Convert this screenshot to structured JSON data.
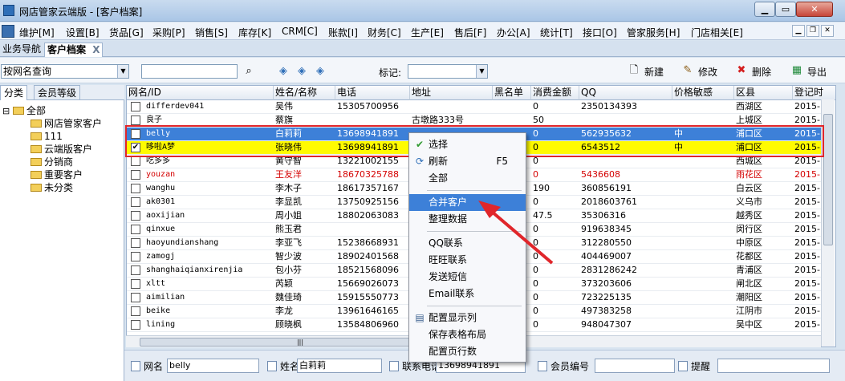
{
  "window": {
    "title": "网店管家云端版 - [客户档案]"
  },
  "menu": [
    "维护[M]",
    "设置[B]",
    "货品[G]",
    "采购[P]",
    "销售[S]",
    "库存[K]",
    "CRM[C]",
    "账款[I]",
    "财务[C]",
    "生产[E]",
    "售后[F]",
    "办公[A]",
    "统计[T]",
    "接口[O]",
    "管家服务[H]",
    "门店相关[E]"
  ],
  "tabs": {
    "nav": "业务导航",
    "active": "客户档案",
    "close": "X"
  },
  "toolbar": {
    "search_mode": "按网名查询",
    "mark_label": "标记:",
    "new": "新建",
    "edit": "修改",
    "delete": "删除",
    "export": "导出"
  },
  "sidebar": {
    "tabs": [
      "分类",
      "会员等级"
    ],
    "tree": [
      "全部",
      "网店管家客户",
      "111",
      "云端版客户",
      "分销商",
      "重要客户",
      "未分类"
    ],
    "toggle": "⊟"
  },
  "grid": {
    "columns": [
      "网名/ID",
      "姓名/名称",
      "电话",
      "地址",
      "黑名单",
      "消费金额",
      "QQ",
      "价格敏感",
      "区县",
      "登记时"
    ],
    "rows": [
      {
        "nick": "differdev041",
        "name": "吴伟",
        "phone": "15305700956",
        "addr": "",
        "black": "",
        "amount": "0",
        "qq": "2350134393",
        "price": "",
        "district": "西湖区",
        "reg": "2015-",
        "checked": "",
        "style": ""
      },
      {
        "nick": "良子",
        "name": "蔡旗",
        "phone": "",
        "addr": "古墩路333号",
        "black": "",
        "amount": "50",
        "qq": "",
        "price": "",
        "district": "上城区",
        "reg": "2015-",
        "checked": "",
        "style": ""
      },
      {
        "nick": "belly",
        "name": "白莉莉",
        "phone": "13698941891",
        "addr": "",
        "black": "",
        "amount": "0",
        "qq": "562935632",
        "price": "中",
        "district": "浦口区",
        "reg": "2015-",
        "checked": "✔",
        "style": "sel"
      },
      {
        "nick": "哆啦A梦",
        "name": "张晓伟",
        "phone": "13698941891",
        "addr": "",
        "black": "",
        "amount": "0",
        "qq": "6543512",
        "price": "中",
        "district": "浦口区",
        "reg": "2015-",
        "checked": "✔",
        "style": "hl"
      },
      {
        "nick": "吃多多",
        "name": "黄守智",
        "phone": "13221002155",
        "addr": "",
        "black": "",
        "amount": "0",
        "qq": "",
        "price": "",
        "district": "西城区",
        "reg": "2015-",
        "checked": "",
        "style": ""
      },
      {
        "nick": "youzan",
        "name": "王友洋",
        "phone": "18670325788",
        "addr": "",
        "black": "",
        "amount": "0",
        "qq": "5436608",
        "price": "",
        "district": "雨花区",
        "reg": "2015-",
        "checked": "",
        "style": "red"
      },
      {
        "nick": "wanghu",
        "name": "李木子",
        "phone": "18617357167",
        "addr": "",
        "black": "",
        "amount": "190",
        "qq": "360856191",
        "price": "",
        "district": "白云区",
        "reg": "2015-",
        "checked": "",
        "style": ""
      },
      {
        "nick": "ak0301",
        "name": "李显凯",
        "phone": "13750925156",
        "addr": "",
        "black": "",
        "amount": "0",
        "qq": "2018603761",
        "price": "",
        "district": "义乌市",
        "reg": "2015-",
        "checked": "",
        "style": ""
      },
      {
        "nick": "aoxijian",
        "name": "周小姐",
        "phone": "18802063083",
        "addr": "",
        "black": "",
        "amount": "47.5",
        "qq": "35306316",
        "price": "",
        "district": "越秀区",
        "reg": "2015-",
        "checked": "",
        "style": ""
      },
      {
        "nick": "qinxue",
        "name": "熊玉君",
        "phone": "",
        "addr": "",
        "black": "",
        "amount": "0",
        "qq": "919638345",
        "price": "",
        "district": "闵行区",
        "reg": "2015-",
        "checked": "",
        "style": ""
      },
      {
        "nick": "haoyundianshang",
        "name": "李亚飞",
        "phone": "15238668931",
        "addr": "",
        "black": "",
        "amount": "0",
        "qq": "312280550",
        "price": "",
        "district": "中原区",
        "reg": "2015-",
        "checked": "",
        "style": ""
      },
      {
        "nick": "zamogj",
        "name": "智少波",
        "phone": "18902401568",
        "addr": "",
        "black": "",
        "amount": "0",
        "qq": "404469007",
        "price": "",
        "district": "花都区",
        "reg": "2015-",
        "checked": "",
        "style": ""
      },
      {
        "nick": "shanghaiqianxirenjia",
        "name": "包小芬",
        "phone": "18521568096",
        "addr": "",
        "black": "",
        "amount": "0",
        "qq": "2831286242",
        "price": "",
        "district": "青浦区",
        "reg": "2015-",
        "checked": "",
        "style": ""
      },
      {
        "nick": "xltt",
        "name": "芮颖",
        "phone": "15669026073",
        "addr": "",
        "black": "",
        "amount": "0",
        "qq": "373203606",
        "price": "",
        "district": "闸北区",
        "reg": "2015-",
        "checked": "",
        "style": ""
      },
      {
        "nick": "aimilian",
        "name": "魏佳琦",
        "phone": "15915550773",
        "addr": "",
        "black": "",
        "amount": "0",
        "qq": "723225135",
        "price": "",
        "district": "潮阳区",
        "reg": "2015-",
        "checked": "",
        "style": ""
      },
      {
        "nick": "beike",
        "name": "李龙",
        "phone": "13961646165",
        "addr": "",
        "black": "",
        "amount": "0",
        "qq": "497383258",
        "price": "",
        "district": "江阴市",
        "reg": "2015-",
        "checked": "",
        "style": ""
      },
      {
        "nick": "lining",
        "name": "顾晓枫",
        "phone": "13584806960",
        "addr": "",
        "black": "",
        "amount": "0",
        "qq": "948047307",
        "price": "",
        "district": "吴中区",
        "reg": "2015-",
        "checked": "",
        "style": ""
      }
    ]
  },
  "context_menu": {
    "select": "选择",
    "refresh": "刷新",
    "refresh_key": "F5",
    "all": "全部",
    "merge": "合并客户",
    "organize": "整理数据",
    "qq": "QQ联系",
    "wangwang": "旺旺联系",
    "sms": "发送短信",
    "email": "Email联系",
    "config_cols": "配置显示列",
    "save_layout": "保存表格布局",
    "config_page": "配置页行数"
  },
  "bottom": {
    "nick_label": "网名",
    "nick_value": "belly",
    "name_label": "姓名",
    "name_value": "白莉莉",
    "phone_label": "联系电话",
    "phone_value": "13698941891",
    "member_label": "会员编号",
    "remind_label": "提醒"
  },
  "colors": {
    "selection": "#3d80d8",
    "highlight": "#fffb00",
    "annotation": "#e0262b"
  }
}
